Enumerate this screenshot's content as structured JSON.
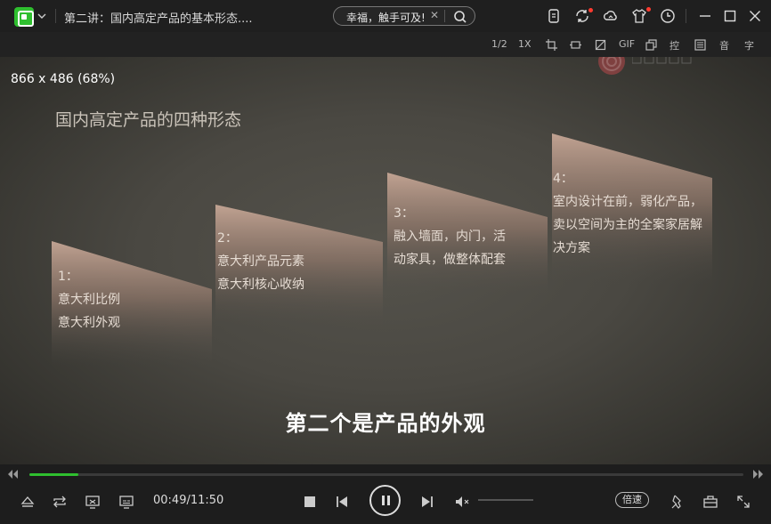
{
  "titlebar": {
    "video_title": "第二讲：国内高定产品的基本形态....",
    "search_text": "幸福，触手可及!",
    "search_clear": "✕",
    "accent_color": "#2fbf2f",
    "notification_color": "#ff3b30"
  },
  "toolstrip": {
    "items": [
      "1/2",
      "1X",
      "GIF",
      "控",
      "音",
      "字"
    ]
  },
  "video": {
    "resolution_label": "866 x 486 (68%)",
    "slide_title": "国内高定产品的四种形态",
    "panels": [
      {
        "label_lines": [
          "1：",
          "意大利比例",
          "意大利外观"
        ]
      },
      {
        "label_lines": [
          "2：",
          "意大利产品元素",
          "意大利核心收纳"
        ]
      },
      {
        "label_lines": [
          "3：",
          "融入墙面，内门，活",
          "动家具，做整体配套"
        ]
      },
      {
        "label_lines": [
          "4：",
          "室内设计在前，弱化产品，",
          "卖以空间为主的全案家居解",
          "决方案"
        ]
      }
    ],
    "subtitle": "第二个是产品的外观"
  },
  "playback": {
    "current_time": "00:49",
    "total_time": "11:50",
    "time_display": "00:49/11:50",
    "progress_fraction": 0.069,
    "volume_fraction": 0.0,
    "speed_label": "倍速"
  }
}
